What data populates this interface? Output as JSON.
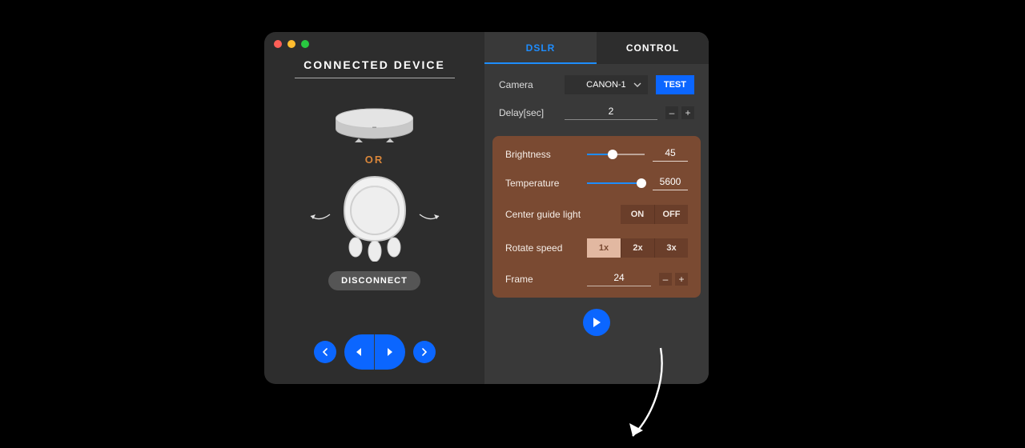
{
  "left": {
    "title": "CONNECTED DEVICE",
    "or_label": "OR",
    "disconnect_label": "DISCONNECT"
  },
  "tabs": {
    "dslr": "DSLR",
    "control": "CONTROL",
    "active": "dslr"
  },
  "dslr": {
    "camera_label": "Camera",
    "camera_value": "CANON-1",
    "test_label": "TEST",
    "delay_label": "Delay[sec]",
    "delay_value": "2"
  },
  "lighting": {
    "brightness_label": "Brightness",
    "brightness_value": "45",
    "brightness_pct": 45,
    "temperature_label": "Temperature",
    "temperature_value": "5600",
    "temperature_pct": 95,
    "center_guide_label": "Center guide light",
    "center_guide_on": "ON",
    "center_guide_off": "OFF",
    "rotate_speed_label": "Rotate speed",
    "speed_options": {
      "x1": "1x",
      "x2": "2x",
      "x3": "3x"
    },
    "speed_selected": "x1",
    "frame_label": "Frame",
    "frame_value": "24"
  },
  "icons": {
    "minus": "–",
    "plus": "+"
  }
}
